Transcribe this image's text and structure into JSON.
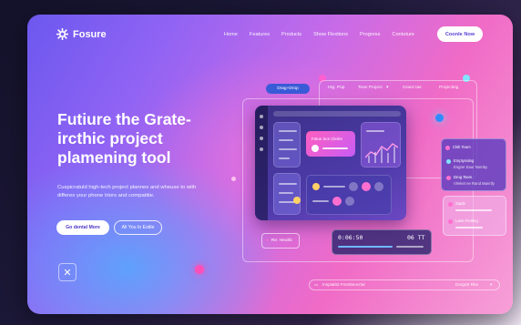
{
  "brand": {
    "name": "Fosure"
  },
  "nav": {
    "items": [
      "Home",
      "Features",
      "Products",
      "Show Flextions",
      "Progress",
      "Contuture"
    ],
    "cta_label": "Coonle Now"
  },
  "hero": {
    "headline": "Futiure the Grate-ircthic project plamening tool",
    "subtext": "Cuspicratuld high-tech project plannes and wheuse to with differes your phone triors and compatitie.",
    "primary_button": "Go dental More",
    "secondary_button": "All You In Estile"
  },
  "mockup": {
    "drag_label": "Drag+Drop",
    "tabs": [
      "Hig: Pop",
      "Tean Project",
      "Gracs tas",
      "Projecting"
    ],
    "card_title": "Fatue Sce Clerite",
    "side_panel": {
      "title": "Clsh Team",
      "item1_title": "Emptyrating",
      "item1_sub": "Engrer Eaur Nomby",
      "item2_title": "Drog Tsem",
      "item2_sub": "Vireket ee Rand Manrtly"
    },
    "panel2": {
      "item1": "Stade",
      "item2": "Lane Fretting"
    },
    "ghost_label": "Re: Heuthi",
    "timer_left": "0:06:50",
    "timer_right": "06 TT",
    "footer_left": "Insplatitd Frnmlteocrtal",
    "footer_right": "Drogort Rhe"
  },
  "colors": {
    "accent": "#5b3fd6",
    "gradient_start": "#6c58ee",
    "gradient_end": "#f7a0d8",
    "pink_highlight": "#ff5fbf",
    "cyan_dot": "#7fe6ff"
  }
}
